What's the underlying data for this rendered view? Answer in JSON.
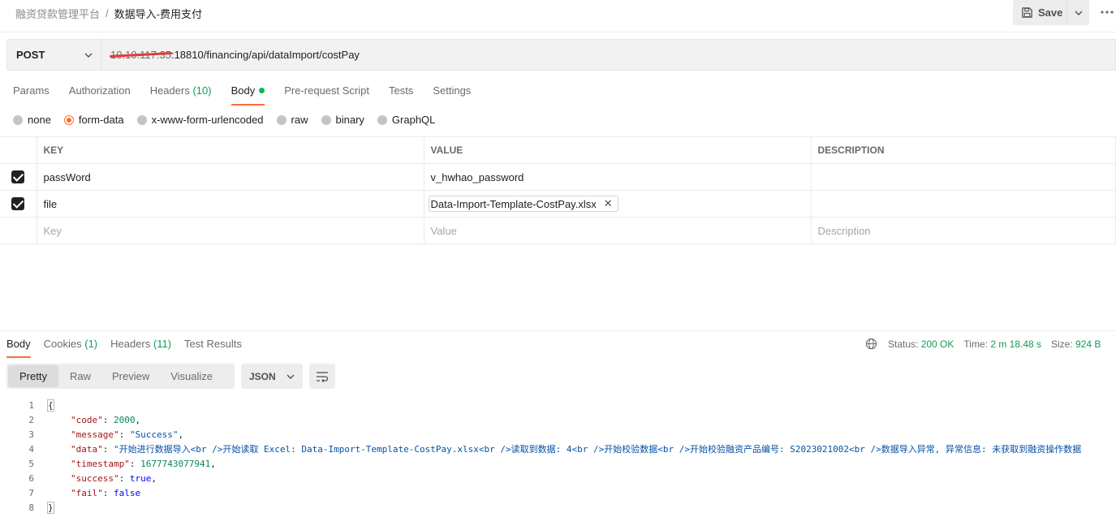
{
  "header": {
    "breadcrumb_parent": "融资贷款管理平台",
    "breadcrumb_sep": "/",
    "title": "数据导入-费用支付",
    "save_label": "Save",
    "more_label": "•••"
  },
  "request": {
    "method": "POST",
    "url_redacted_host": "10.10.117.35",
    "url_rest": ":18810/financing/api/dataImport/costPay"
  },
  "request_tabs": [
    {
      "label": "Params",
      "count": ""
    },
    {
      "label": "Authorization",
      "count": ""
    },
    {
      "label": "Headers",
      "count": "(10)"
    },
    {
      "label": "Body",
      "count": ""
    },
    {
      "label": "Pre-request Script",
      "count": ""
    },
    {
      "label": "Tests",
      "count": ""
    },
    {
      "label": "Settings",
      "count": ""
    }
  ],
  "body_types": [
    "none",
    "form-data",
    "x-www-form-urlencoded",
    "raw",
    "binary",
    "GraphQL"
  ],
  "body_types_selected": "form-data",
  "form_table": {
    "headers": [
      "KEY",
      "VALUE",
      "DESCRIPTION"
    ],
    "rows": [
      {
        "key": "passWord",
        "value": "v_hwhao_password",
        "checked": true
      },
      {
        "key": "file",
        "value": "Data-Import-Template-CostPay.xlsx",
        "checked": true,
        "is_file": true
      }
    ],
    "placeholder": {
      "key": "Key",
      "value": "Value",
      "description": "Description"
    }
  },
  "response": {
    "tabs": [
      {
        "label": "Body",
        "count": ""
      },
      {
        "label": "Cookies",
        "count": "(1)"
      },
      {
        "label": "Headers",
        "count": "(11)"
      },
      {
        "label": "Test Results",
        "count": ""
      }
    ],
    "status_label": "Status:",
    "status_value": "200 OK",
    "time_label": "Time:",
    "time_value": "2 m 18.48 s",
    "size_label": "Size:",
    "size_value": "924 B",
    "format_modes": [
      "Pretty",
      "Raw",
      "Preview",
      "Visualize"
    ],
    "format_selected": "Pretty",
    "language": "JSON",
    "code_lines": [
      {
        "n": "1",
        "text": "{"
      },
      {
        "n": "2",
        "key": "\"code\"",
        "value": "2000",
        "type": "num"
      },
      {
        "n": "3",
        "key": "\"message\"",
        "value": "\"Success\"",
        "type": "str"
      },
      {
        "n": "4",
        "key": "\"data\"",
        "value": "\"开始进行数据导入<br />开始读取 Excel: Data-Import-Template-CostPay.xlsx<br />读取到数据: 4<br />开始校验数据<br />开始校验融资产品编号: S2023021002<br />数据导入异常, 异常信息: 未获取到融资操作数据",
        "type": "str"
      },
      {
        "n": "5",
        "key": "\"timestamp\"",
        "value": "1677743077941",
        "type": "num"
      },
      {
        "n": "6",
        "key": "\"success\"",
        "value": "true",
        "type": "bool"
      },
      {
        "n": "7",
        "key": "\"fail\"",
        "value": "false",
        "type": "bool",
        "last": true
      },
      {
        "n": "8",
        "text": "}"
      }
    ]
  },
  "colors": {
    "accent": "#ff6c37",
    "green": "#0f9d58",
    "redaction": "#e53935"
  }
}
